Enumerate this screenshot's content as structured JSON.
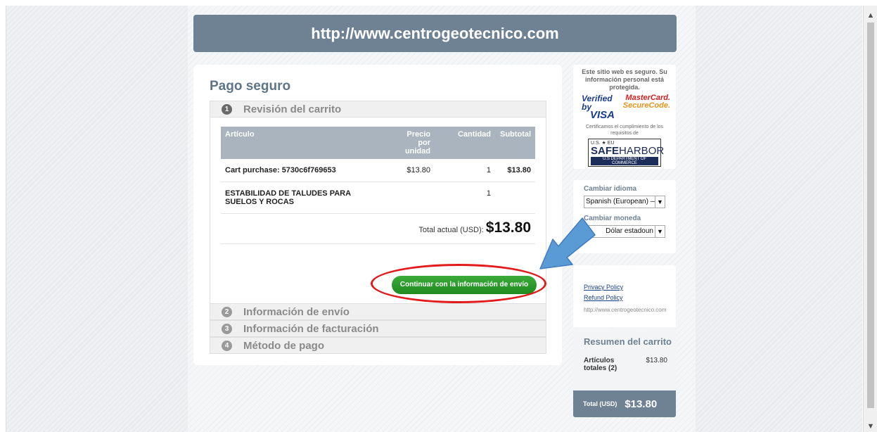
{
  "banner": {
    "url": "http://www.centrogeotecnico.com"
  },
  "checkout": {
    "title": "Pago seguro",
    "steps": [
      {
        "number": "1",
        "label": "Revisión del carrito"
      },
      {
        "number": "2",
        "label": "Información de envío"
      },
      {
        "number": "3",
        "label": "Información de facturación"
      },
      {
        "number": "4",
        "label": "Método de pago"
      }
    ],
    "table": {
      "headers": {
        "item": "Artículo",
        "price": "Precio por unidad",
        "qty": "Cantidad",
        "subtotal": "Subtotal"
      },
      "rows": [
        {
          "item": "Cart purchase: 5730c6f769653",
          "price": "$13.80",
          "qty": "1",
          "subtotal": "$13.80"
        },
        {
          "item": "ESTABILIDAD DE TALUDES PARA SUELOS Y ROCAS",
          "price": "",
          "qty": "1",
          "subtotal": ""
        }
      ],
      "total_label": "Total actual (USD):",
      "total_amount": "$13.80"
    },
    "continue_label": "Continuar con la información de envío"
  },
  "sidebar": {
    "secure_text": "Este sitio web es seguro. Su información personal está protegida.",
    "visa": {
      "line1": "Verified by",
      "line2": "VISA"
    },
    "mastercard": {
      "line1": "MasterCard.",
      "line2": "SecureCode."
    },
    "certify_text": "Certificamos el cumplimiento de los requisitos de",
    "safeharbor": {
      "top": "U.S. ★ EU",
      "main_bold": "SAFE",
      "main_light": "HARBOR",
      "dept": "U.S DEPARTMENT OF COMMERCE"
    },
    "language_label": "Cambiar idioma",
    "language_value": "Spanish (European) —",
    "currency_label": "Cambiar moneda",
    "currency_value": "Dólar estadoun",
    "privacy_link": "Privacy Policy",
    "refund_link": "Refund Policy",
    "site_url": "http://www.centrogeotecnico.com",
    "summary_title": "Resumen del carrito",
    "summary_items_label": "Artículos totales (2)",
    "summary_items_value": "$13.80",
    "total_label": "Total (USD)",
    "total_value": "$13.80"
  },
  "annotation_colors": {
    "arrow": "#5b9bd5",
    "ellipse": "#e21c1c"
  }
}
